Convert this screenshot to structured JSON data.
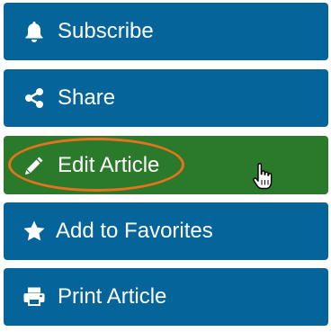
{
  "menu": {
    "items": [
      {
        "label": "Subscribe",
        "icon": "bell-icon"
      },
      {
        "label": "Share",
        "icon": "share-icon"
      },
      {
        "label": "Edit Article",
        "icon": "pencil-icon",
        "state": "hovered"
      },
      {
        "label": "Add to Favorites",
        "icon": "star-icon"
      },
      {
        "label": "Print Article",
        "icon": "printer-icon"
      }
    ]
  },
  "annotation": {
    "highlight": "orange-ellipse",
    "highlight_color": "#e5731e"
  },
  "cursor": {
    "type": "hand-pointer-icon"
  },
  "colors": {
    "button_blue": "#05649a",
    "button_green": "#2b7a2b",
    "text": "#ffffff"
  }
}
